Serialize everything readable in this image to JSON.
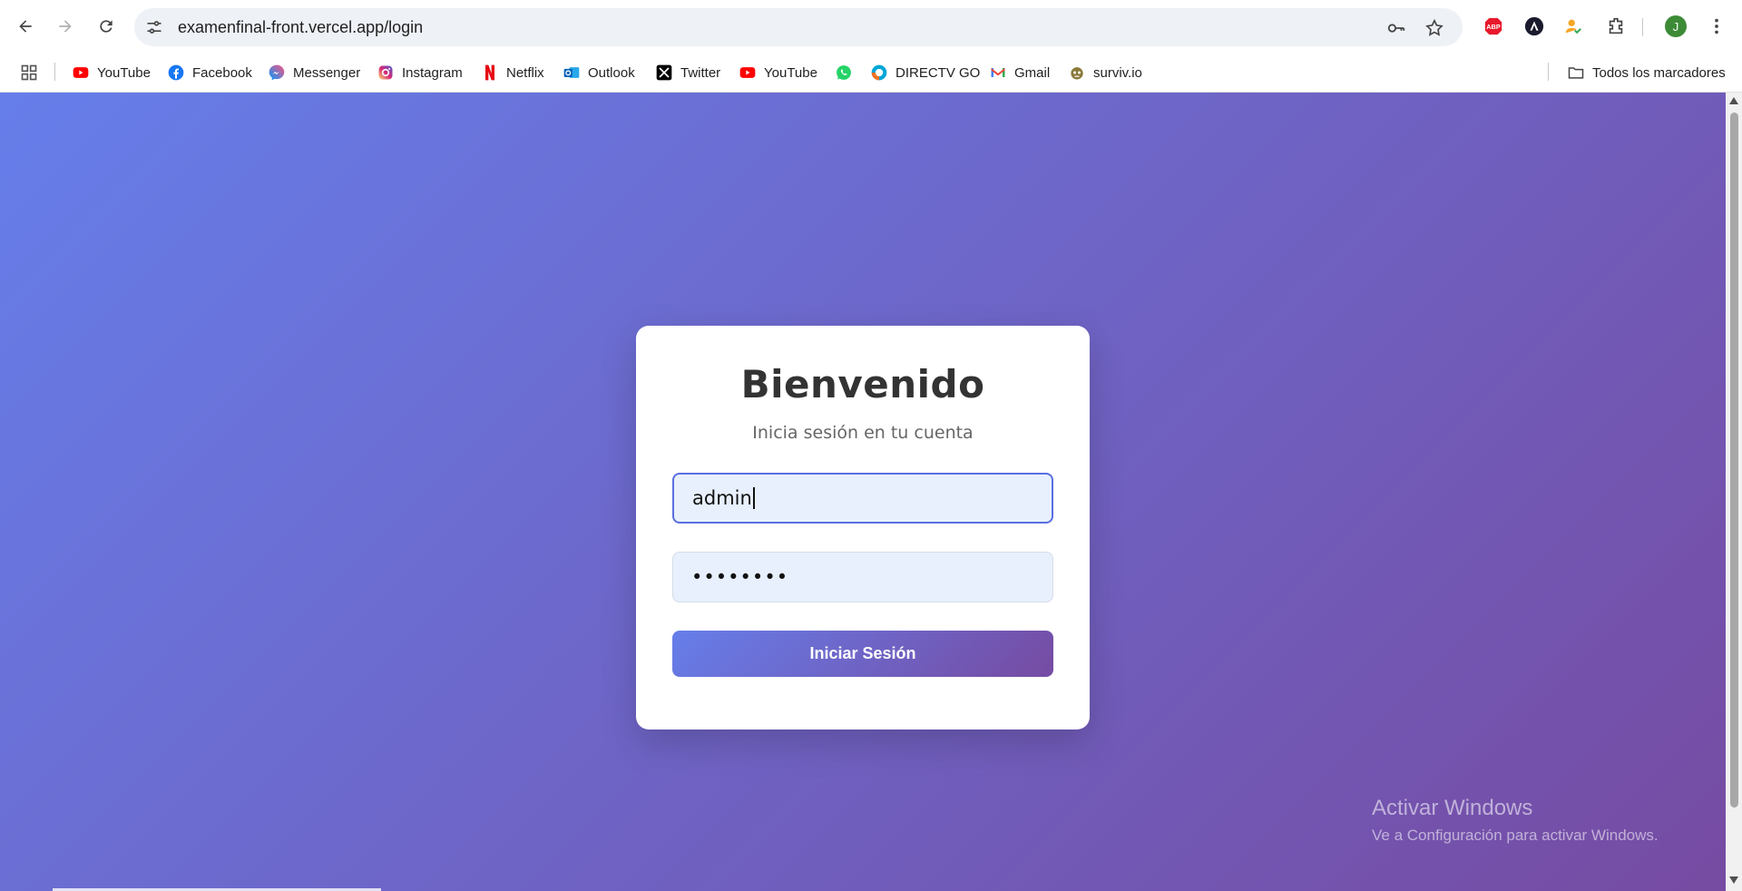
{
  "browser": {
    "url": "examenfinal-front.vercel.app/login",
    "profile_initial": "J",
    "colors": {
      "profile": "#3d8b37",
      "abp": "#e8192c"
    }
  },
  "bookmarks": {
    "items": [
      {
        "label": "YouTube",
        "icon": "youtube-icon"
      },
      {
        "label": "Facebook",
        "icon": "facebook-icon"
      },
      {
        "label": "Messenger",
        "icon": "messenger-icon"
      },
      {
        "label": "Instagram",
        "icon": "instagram-icon"
      },
      {
        "label": "Netflix",
        "icon": "netflix-icon"
      },
      {
        "label": "Outlook",
        "icon": "outlook-icon"
      },
      {
        "label": "Twitter",
        "icon": "x-twitter-icon"
      },
      {
        "label": "YouTube",
        "icon": "youtube-icon"
      },
      {
        "label": "",
        "icon": "whatsapp-icon"
      },
      {
        "label": "DIRECTV GO",
        "icon": "directv-icon"
      },
      {
        "label": "Gmail",
        "icon": "gmail-icon"
      },
      {
        "label": "surviv.io",
        "icon": "surviv-icon"
      }
    ],
    "all_bookmarks": "Todos los marcadores"
  },
  "login": {
    "title": "Bienvenido",
    "subtitle": "Inicia sesión en tu cuenta",
    "username_value": "admin",
    "password_value": "••••••••",
    "submit_label": "Iniciar Sesión",
    "colors": {
      "gradient_start": "#667eea",
      "gradient_end": "#764ba2"
    }
  },
  "watermark": {
    "line1": "Activar Windows",
    "line2": "Ve a Configuración para activar Windows."
  }
}
